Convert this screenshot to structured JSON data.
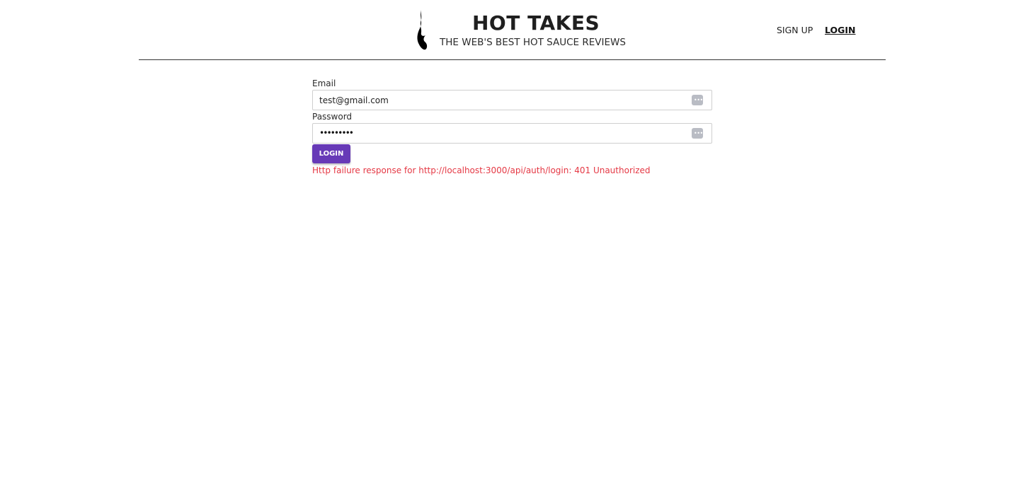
{
  "header": {
    "title": "HOT TAKES",
    "tagline": "THE WEB'S BEST HOT SAUCE REVIEWS",
    "logo_icon": "flame-icon"
  },
  "nav": {
    "signup_label": "SIGN UP",
    "login_label": "LOGIN"
  },
  "form": {
    "email_label": "Email",
    "email_value": "test@gmail.com",
    "password_label": "Password",
    "password_value": "•••••••••",
    "autofill_icon": "autofill-key-icon",
    "submit_label": "LOGIN",
    "error": "Http failure response for http://localhost:3000/api/auth/login: 401 Unauthorized"
  },
  "colors": {
    "primary": "#673ab7",
    "error": "#e53945"
  }
}
